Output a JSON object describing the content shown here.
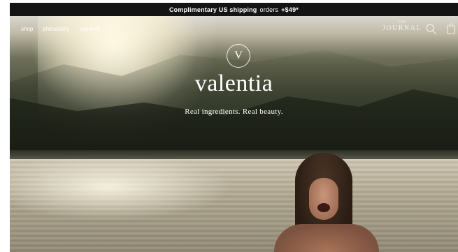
{
  "promo": {
    "text_bold": "Complimentary US shipping",
    "text_regular": "orders",
    "threshold": "+$49*"
  },
  "nav": {
    "items": [
      "shop",
      "philosophy",
      "connect"
    ]
  },
  "journal": {
    "small": "THE",
    "title": "JOURNAL"
  },
  "icons": {
    "search": "search-icon",
    "bag": "shopping-bag-icon"
  },
  "hero": {
    "monogram": "V",
    "brand": "valentia",
    "tagline": "Real ingredients. Real beauty."
  }
}
